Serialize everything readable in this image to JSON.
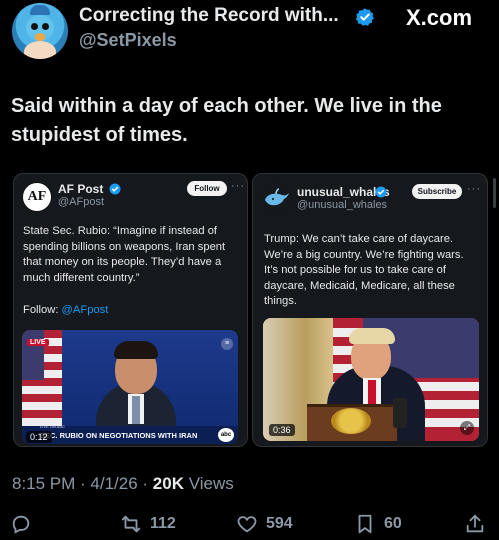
{
  "header": {
    "display_name": "Correcting the Record with...",
    "handle": "@SetPixels",
    "platform_logo": "X.com"
  },
  "tweet": {
    "text": "Said within a day of each other. We live in the stupidest of times."
  },
  "card_left": {
    "avatar_text": "AF",
    "name": "AF Post",
    "handle": "@AFpost",
    "button": "Follow",
    "text": "State Sec. Rubio: “Imagine if instead of spending billions on weapons, Iran spent that money on its people. They’d have a much different country.”",
    "follow_prefix": "Follow: ",
    "follow_link": "@AFpost",
    "video": {
      "live_label": "LIVE",
      "time": "0:12",
      "chyron": "SEC. RUBIO ON NEGOTIATIONS WITH IRAN",
      "chyron_top": "LIVE ON ABC",
      "network": "abc"
    }
  },
  "card_right": {
    "name": "unusual_whales",
    "handle": "@unusual_whales",
    "button": "Subscribe",
    "text": "Trump: We can’t take care of daycare. We’re a big country. We’re fighting wars. It’s not possible for us to take care of daycare, Medicaid, Medicare, all these things.",
    "video": {
      "time": "0:36"
    }
  },
  "meta": {
    "time": "8:15 PM",
    "date": "4/1/26",
    "views_count": "20K",
    "views_label": "Views"
  },
  "actions": {
    "reply_count": "",
    "retweet_count": "112",
    "like_count": "594",
    "bookmark_count": "60"
  },
  "colors": {
    "background": "#000000",
    "text": "#e7e9ea",
    "muted": "#8b98a5",
    "accent": "#1d9bf0"
  }
}
